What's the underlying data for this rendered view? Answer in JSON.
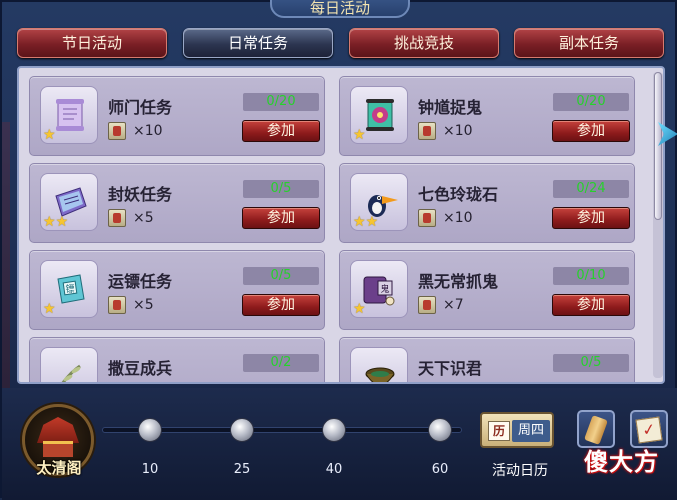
{
  "window": {
    "title": "每日活动"
  },
  "tabs": [
    {
      "label": "节日活动",
      "active": false
    },
    {
      "label": "日常任务",
      "active": true
    },
    {
      "label": "挑战竞技",
      "active": false
    },
    {
      "label": "副本任务",
      "active": false
    }
  ],
  "tasks": [
    {
      "name": "师门任务",
      "reward_count": "×10",
      "progress": "0/20",
      "stars": 1,
      "join_label": "参加",
      "icon": "scroll-icon"
    },
    {
      "name": "钟馗捉鬼",
      "reward_count": "×10",
      "progress": "0/20",
      "stars": 1,
      "join_label": "参加",
      "icon": "ghost-scroll-icon"
    },
    {
      "name": "封妖任务",
      "reward_count": "×5",
      "progress": "0/5",
      "stars": 2,
      "join_label": "参加",
      "icon": "book-icon"
    },
    {
      "name": "七色玲珑石",
      "reward_count": "×10",
      "progress": "0/24",
      "stars": 2,
      "join_label": "参加",
      "icon": "toucan-icon"
    },
    {
      "name": "运镖任务",
      "reward_count": "×5",
      "progress": "0/5",
      "stars": 1,
      "join_label": "参加",
      "icon": "escort-book-icon"
    },
    {
      "name": "黑无常抓鬼",
      "reward_count": "×7",
      "progress": "0/10",
      "stars": 1,
      "join_label": "参加",
      "icon": "purple-scroll-icon"
    },
    {
      "name": "撒豆成兵",
      "reward_count": "",
      "progress": "0/2",
      "stars": 0,
      "join_label": "",
      "icon": "plant-icon"
    },
    {
      "name": "天下识君",
      "reward_count": "",
      "progress": "0/5",
      "stars": 0,
      "join_label": "",
      "icon": "bowl-icon"
    }
  ],
  "bottom": {
    "emblem_label": "太清阁",
    "milestones": [
      "10",
      "25",
      "40",
      "60"
    ],
    "calendar": {
      "icon_char": "历",
      "day": "周四",
      "label": "活动日历"
    }
  },
  "watermark": "傻大方",
  "colors": {
    "progress_text": "#27d12c",
    "tab_red": "#8e1b1c",
    "panel_bg": "#d9d6e6"
  }
}
